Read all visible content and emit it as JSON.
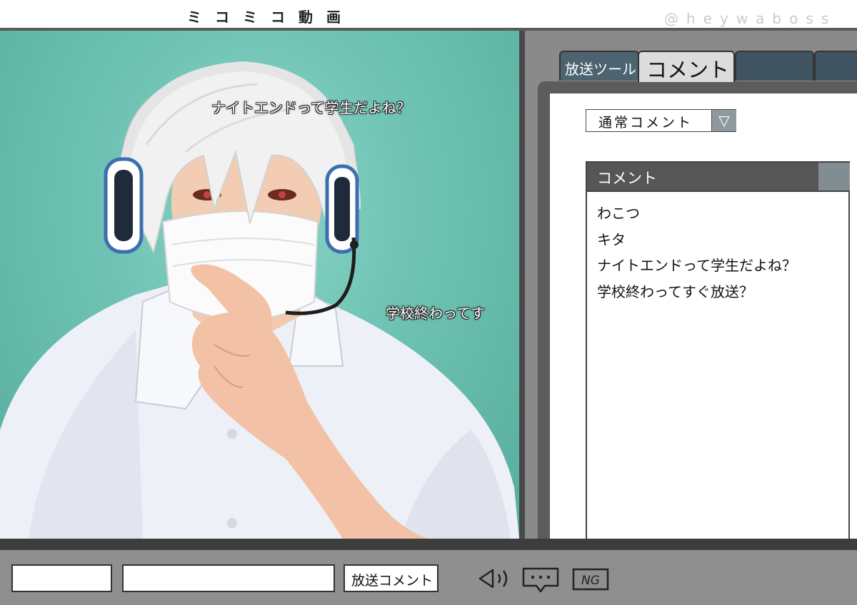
{
  "app": {
    "title": "ミコミコ動画",
    "watermark": "@heywaboss"
  },
  "video": {
    "danmaku": [
      "ナイトエンドって学生だよね？",
      "学校終わってす"
    ]
  },
  "panel": {
    "tabs": [
      {
        "label": "放送ツール",
        "active": false
      },
      {
        "label": "コメント",
        "active": true
      },
      {
        "label": "",
        "active": false
      },
      {
        "label": "",
        "active": false
      }
    ],
    "select": {
      "value": "通常コメント",
      "arrow": "▽"
    },
    "list": {
      "header": "コメント",
      "items": [
        "わこつ",
        "キタ",
        "ナイトエンドって学生だよね？",
        "学校終わってすぐ放送？"
      ]
    }
  },
  "bottom": {
    "send_label": "放送コメント",
    "icons": [
      "speaker-icon",
      "chat-bubble-icon",
      "ng-filter-icon"
    ],
    "ng_text": "NG"
  },
  "colors": {
    "video_bg": "#6fbfae",
    "tab_dark": "#3f5460",
    "panel_gray": "#8a8a8a",
    "header_gray": "#565656"
  }
}
